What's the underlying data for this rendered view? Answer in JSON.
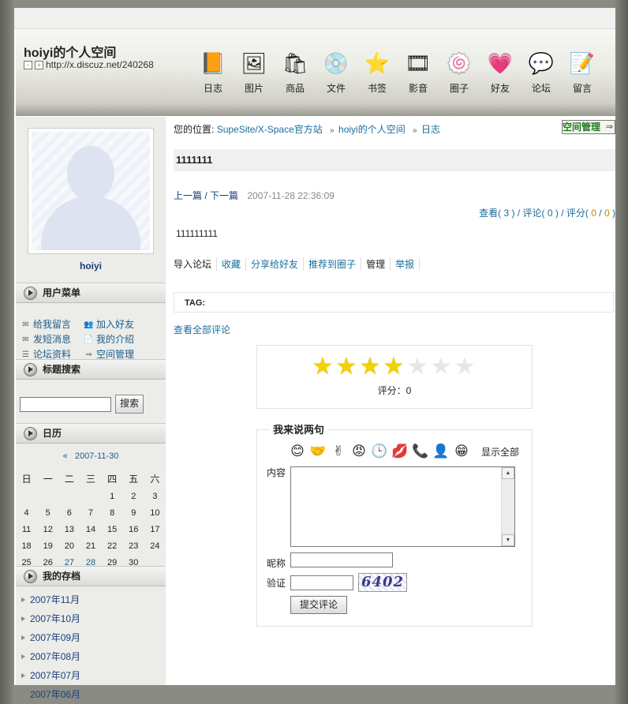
{
  "header": {
    "site_title": "hoiyi的个人空间",
    "site_url": "http://x.discuz.net/240268",
    "nav": [
      {
        "label": "日志",
        "icon": "📙",
        "name": "nav-blog"
      },
      {
        "label": "图片",
        "icon": "🖼",
        "name": "nav-images"
      },
      {
        "label": "商品",
        "icon": "🛍",
        "name": "nav-goods"
      },
      {
        "label": "文件",
        "icon": "💿",
        "name": "nav-files"
      },
      {
        "label": "书签",
        "icon": "⭐",
        "name": "nav-bookmarks"
      },
      {
        "label": "影音",
        "icon": "🎞",
        "name": "nav-media"
      },
      {
        "label": "圈子",
        "icon": "🍥",
        "name": "nav-circles"
      },
      {
        "label": "好友",
        "icon": "💗",
        "name": "nav-friends"
      },
      {
        "label": "论坛",
        "icon": "💬",
        "name": "nav-forum"
      },
      {
        "label": "留言",
        "icon": "📝",
        "name": "nav-guestbook"
      }
    ]
  },
  "sidebar": {
    "username": "hoiyi",
    "user_menu_title": "用户菜单",
    "user_menu": [
      [
        "给我留言",
        "加入好友"
      ],
      [
        "发短消息",
        "我的介绍"
      ],
      [
        "论坛资料",
        "空间管理"
      ]
    ],
    "search_title": "标题搜索",
    "search_button": "搜索",
    "calendar_title": "日历",
    "calendar_prev": "«",
    "calendar_month": "2007-11-30",
    "weekdays": [
      "日",
      "一",
      "二",
      "三",
      "四",
      "五",
      "六"
    ],
    "weeks": [
      [
        "",
        "",
        "",
        "",
        "1",
        "2",
        "3"
      ],
      [
        "4",
        "5",
        "6",
        "7",
        "8",
        "9",
        "10"
      ],
      [
        "11",
        "12",
        "13",
        "14",
        "15",
        "16",
        "17"
      ],
      [
        "18",
        "19",
        "20",
        "21",
        "22",
        "23",
        "24"
      ],
      [
        "25",
        "26",
        "27",
        "28",
        "29",
        "30",
        ""
      ]
    ],
    "archive_title": "我的存档",
    "archives": [
      "2007年11月",
      "2007年10月",
      "2007年09月",
      "2007年08月",
      "2007年07月",
      "2007年06月"
    ]
  },
  "main": {
    "breadcrumb_prefix": "您的位置:",
    "breadcrumb": [
      "SupeSite/X-Space官方站",
      "hoiyi的个人空间",
      "日志"
    ],
    "breadcrumb_sep": "»",
    "space_manage": "空间管理",
    "post_title": "1111111",
    "prev": "上一篇",
    "next": "/ 下一篇",
    "post_date": "2007-11-28 22:36:09",
    "stats": {
      "view_label": "查看",
      "views": "3",
      "comment_label": "评论",
      "comments": "0",
      "score_label": "评分",
      "score_a": "0",
      "score_b": "0"
    },
    "content": "111111111",
    "actions": [
      "导入论坛",
      "收藏",
      "分享给好友",
      "推荐到圈子",
      "管理",
      "举报"
    ],
    "tag_label": "TAG:",
    "all_comments": "查看全部评论",
    "rating": {
      "filled": 4,
      "total": 7,
      "label": "评分：0"
    },
    "comment_form": {
      "legend": "我来说两句",
      "show_all": "显示全部",
      "content_label": "内容",
      "nickname_label": "昵称",
      "code_label": "验证",
      "captcha": "6402",
      "submit": "提交评论"
    }
  }
}
